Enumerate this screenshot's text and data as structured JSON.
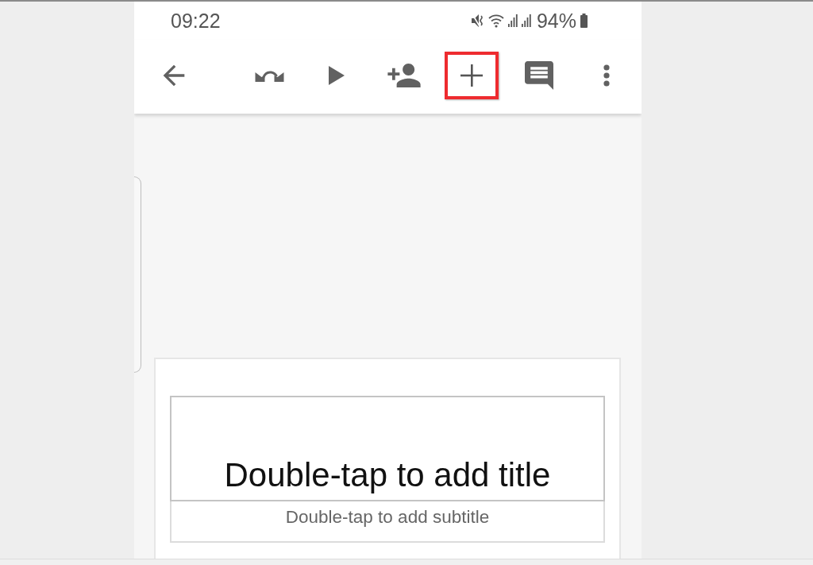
{
  "status_bar": {
    "time": "09:22",
    "battery_percent": "94%"
  },
  "toolbar": {
    "buttons": [
      {
        "kind": "back",
        "highlighted": false
      },
      {
        "kind": "swap",
        "highlighted": false
      },
      {
        "kind": "play",
        "highlighted": false
      },
      {
        "kind": "share",
        "highlighted": false
      },
      {
        "kind": "add",
        "highlighted": true
      },
      {
        "kind": "comment",
        "highlighted": false
      },
      {
        "kind": "more",
        "highlighted": false
      }
    ]
  },
  "slide": {
    "title": {
      "placeholder": "Double-tap to add title"
    },
    "subtitle": {
      "placeholder": "Double-tap to add subtitle"
    }
  }
}
